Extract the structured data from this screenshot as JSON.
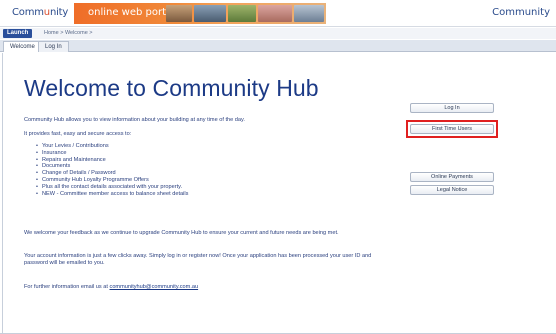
{
  "header": {
    "logo_left_part1": "Comm",
    "logo_left_o": "u",
    "logo_left_part2": "nity",
    "portal_label": "online web portal",
    "logo_right": "Community"
  },
  "nav": {
    "launch_label": "Launch",
    "breadcrumb": "Home > Welcome >"
  },
  "tabs": [
    {
      "label": "Welcome",
      "active": true
    },
    {
      "label": "Log In",
      "active": false
    }
  ],
  "main": {
    "title": "Welcome to Community Hub",
    "intro": "Community Hub allows you to view information about your building at any time of the day.",
    "secure": "It provides fast, easy and secure access to:",
    "bullets": [
      "Your Levies / Contributions",
      "Insurance",
      "Repairs and Maintenance",
      "Documents",
      "Change of Details / Password",
      "Community Hub Loyalty Programme Offers",
      "Plus all the contact details associated with your property.",
      "NEW - Committee member access to balance sheet details"
    ],
    "feedback": "We welcome your feedback as we continue to upgrade Community Hub to ensure your current and future needs are being met.",
    "account": "Your account information is just a few clicks away. Simply log in or register now! Once your application has been processed your user ID and password will be emailed to you.",
    "further_prefix": "For further information email us at",
    "email": "communityhub@community.com.au"
  },
  "sidebar_buttons": {
    "log_in": "Log In",
    "first_time_users": "First Time Users",
    "online_payments": "Online Payments",
    "legal_notice": "Legal Notice"
  },
  "colors": {
    "brand_blue": "#1c3a86",
    "portal_orange": "#ef6d28",
    "highlight_red": "#e02020"
  }
}
